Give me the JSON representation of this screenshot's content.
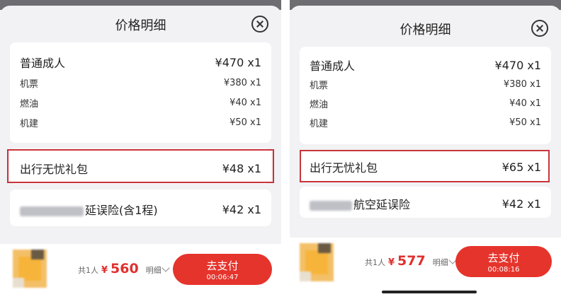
{
  "panels": [
    {
      "title": "价格明细",
      "base": {
        "label": "普通成人",
        "value": "¥470 x1"
      },
      "items": [
        {
          "label": "机票",
          "value": "¥380 x1"
        },
        {
          "label": "燃油",
          "value": "¥40 x1"
        },
        {
          "label": "机建",
          "value": "¥50 x1"
        }
      ],
      "gift": {
        "label": "出行无忧礼包",
        "value": "¥48 x1"
      },
      "insurance": {
        "label": "延误险(含1程)",
        "value": "¥42 x1"
      },
      "footer": {
        "count": "共1人",
        "currency": "¥",
        "total": "560",
        "details": "明细",
        "pay": "去支付",
        "timer": "00:06:47"
      }
    },
    {
      "title": "价格明细",
      "base": {
        "label": "普通成人",
        "value": "¥470 x1"
      },
      "items": [
        {
          "label": "机票",
          "value": "¥380 x1"
        },
        {
          "label": "燃油",
          "value": "¥40 x1"
        },
        {
          "label": "机建",
          "value": "¥50 x1"
        }
      ],
      "gift": {
        "label": "出行无忧礼包",
        "value": "¥65 x1"
      },
      "insurance": {
        "label": "航空延误险",
        "value": "¥42 x1"
      },
      "footer": {
        "count": "共1人",
        "currency": "¥",
        "total": "577",
        "details": "明细",
        "pay": "去支付",
        "timer": "00:08:16"
      }
    }
  ],
  "colors": {
    "accent": "#e5342c",
    "highlight": "#c8343a",
    "background": "#f2f2f4"
  }
}
